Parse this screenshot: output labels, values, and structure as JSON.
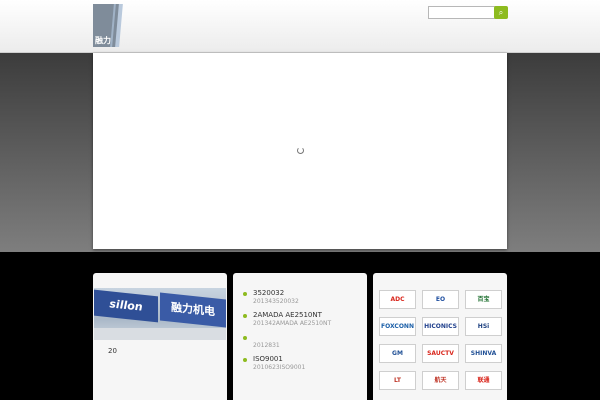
{
  "header": {
    "logo_text": "融力",
    "search": {
      "placeholder": "",
      "button_icon": "search-icon"
    }
  },
  "panels": {
    "about": {
      "image_text_1": "sillon",
      "image_text_2": "融力机电",
      "caption": "20"
    },
    "news": {
      "items": [
        {
          "title": "3520032",
          "date": "201343520032"
        },
        {
          "title": "2AMADA AE2510NT",
          "date": "201342AMADA AE2510NT"
        },
        {
          "title": "",
          "date": "2012831"
        },
        {
          "title": "ISO9001",
          "date": "2010623ISO9001"
        }
      ]
    },
    "partners": {
      "logos": [
        {
          "text": "ADC",
          "color": "#d9261c"
        },
        {
          "text": "EO",
          "color": "#1f4fa0"
        },
        {
          "text": "百宝",
          "color": "#1d6f2e"
        },
        {
          "text": "FOXCONN",
          "color": "#1b5fa8"
        },
        {
          "text": "HICONICS",
          "color": "#1f3f8c"
        },
        {
          "text": "HSi",
          "color": "#1c3f7f"
        },
        {
          "text": "GM",
          "color": "#1f4f95"
        },
        {
          "text": "SAUCTV",
          "color": "#d9261c"
        },
        {
          "text": "SHINVA",
          "color": "#1f4f95"
        },
        {
          "text": "LT",
          "color": "#c0392b"
        },
        {
          "text": "航天",
          "color": "#c0392b"
        },
        {
          "text": "联通",
          "color": "#d9261c"
        }
      ]
    }
  }
}
